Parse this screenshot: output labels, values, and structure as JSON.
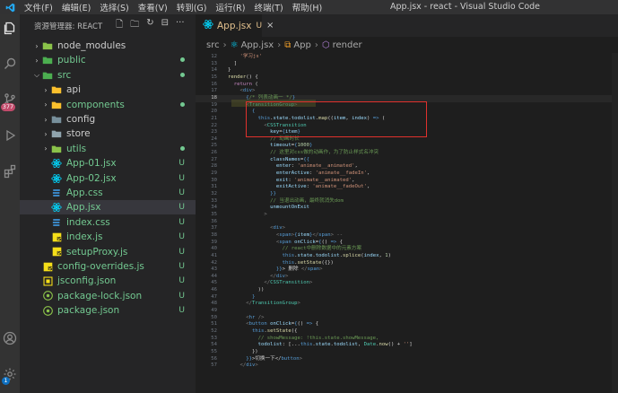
{
  "titlebar": {
    "menus": [
      "文件(F)",
      "编辑(E)",
      "选择(S)",
      "查看(V)",
      "转到(G)",
      "运行(R)",
      "终端(T)",
      "帮助(H)"
    ],
    "window_title": "App.jsx - react - Visual Studio Code"
  },
  "activity": {
    "items": [
      "explorer-icon",
      "search-icon",
      "source-control-icon",
      "run-debug-icon",
      "extensions-icon",
      "account-icon",
      "settings-icon"
    ],
    "scm_badge": "377",
    "settings_badge": "1"
  },
  "sidebar": {
    "title": "资源管理器: REACT",
    "actions": [
      "new-file-icon",
      "new-folder-icon",
      "refresh-icon",
      "collapse-icon",
      "more-icon"
    ],
    "items": [
      {
        "label": "node_modules",
        "type": "folder",
        "depth": 0,
        "expanded": false,
        "color": "#cccccc",
        "status": "",
        "icon_color": "#8bc34a"
      },
      {
        "label": "public",
        "type": "folder",
        "depth": 0,
        "expanded": false,
        "color": "#73c991",
        "status": "dot",
        "icon_color": "#4caf50"
      },
      {
        "label": "src",
        "type": "folder",
        "depth": 0,
        "expanded": true,
        "color": "#73c991",
        "status": "dot",
        "icon_color": "#4caf50"
      },
      {
        "label": "api",
        "type": "folder",
        "depth": 1,
        "expanded": false,
        "color": "#cccccc",
        "status": "",
        "icon_color": "#fbc02d"
      },
      {
        "label": "components",
        "type": "folder",
        "depth": 1,
        "expanded": false,
        "color": "#73c991",
        "status": "dot",
        "icon_color": "#fbc02d"
      },
      {
        "label": "config",
        "type": "folder",
        "depth": 1,
        "expanded": false,
        "color": "#cccccc",
        "status": "",
        "icon_color": "#78909c"
      },
      {
        "label": "store",
        "type": "folder",
        "depth": 1,
        "expanded": false,
        "color": "#cccccc",
        "status": "",
        "icon_color": "#90a4ae"
      },
      {
        "label": "utils",
        "type": "folder",
        "depth": 1,
        "expanded": false,
        "color": "#73c991",
        "status": "dot",
        "icon_color": "#8bc34a"
      },
      {
        "label": "App-01.jsx",
        "type": "react",
        "depth": 1,
        "color": "#73c991",
        "status": "U",
        "icon_color": "#00d8ff"
      },
      {
        "label": "App-02.jsx",
        "type": "react",
        "depth": 1,
        "color": "#73c991",
        "status": "U",
        "icon_color": "#00d8ff"
      },
      {
        "label": "App.css",
        "type": "css",
        "depth": 1,
        "color": "#73c991",
        "status": "U",
        "icon_color": "#42a5f5"
      },
      {
        "label": "App.jsx",
        "type": "react",
        "depth": 1,
        "color": "#73c991",
        "status": "U",
        "icon_color": "#00d8ff",
        "active": true
      },
      {
        "label": "index.css",
        "type": "css",
        "depth": 1,
        "color": "#73c991",
        "status": "U",
        "icon_color": "#42a5f5"
      },
      {
        "label": "index.js",
        "type": "js",
        "depth": 1,
        "color": "#73c991",
        "status": "U",
        "icon_color": "#f5de19"
      },
      {
        "label": "setupProxy.js",
        "type": "js",
        "depth": 1,
        "color": "#73c991",
        "status": "U",
        "icon_color": "#f5de19"
      },
      {
        "label": "config-overrides.js",
        "type": "js",
        "depth": 0,
        "color": "#73c991",
        "status": "U",
        "icon_color": "#f5de19"
      },
      {
        "label": "jsconfig.json",
        "type": "jsconfig",
        "depth": 0,
        "color": "#73c991",
        "status": "U",
        "icon_color": "#f5de19"
      },
      {
        "label": "package-lock.json",
        "type": "npm",
        "depth": 0,
        "color": "#73c991",
        "status": "U",
        "icon_color": "#8bc34a"
      },
      {
        "label": "package.json",
        "type": "npm",
        "depth": 0,
        "color": "#73c991",
        "status": "U",
        "icon_color": "#8bc34a"
      }
    ]
  },
  "editor": {
    "tab": {
      "name": "App.jsx",
      "status": "U",
      "close": "×"
    },
    "breadcrumb": [
      "src",
      "App.jsx",
      "App",
      "render"
    ],
    "current_line": "18",
    "lines": [
      {
        "n": "12",
        "t": [
          [
            "    '学习js'",
            "#ce9178"
          ]
        ]
      },
      {
        "n": "13",
        "t": [
          [
            "  ]",
            "#d4d4d4"
          ]
        ]
      },
      {
        "n": "14",
        "t": [
          [
            "}",
            "#d4d4d4"
          ]
        ]
      },
      {
        "n": "15",
        "t": [
          [
            "render",
            "#dcdcaa"
          ],
          [
            "() {",
            "#d4d4d4"
          ]
        ]
      },
      {
        "n": "16",
        "t": [
          [
            "  return",
            "#c586c0"
          ],
          [
            " (",
            "#d4d4d4"
          ]
        ]
      },
      {
        "n": "17",
        "t": [
          [
            "    <",
            "#808080"
          ],
          [
            "div",
            "#569cd6"
          ],
          [
            ">",
            "#808080"
          ]
        ]
      },
      {
        "n": "18",
        "t": [
          [
            "      {",
            "#569cd6"
          ],
          [
            "/* 列表动画一 */",
            "#6a9955"
          ],
          [
            "}",
            "#569cd6"
          ]
        ]
      },
      {
        "n": "19",
        "t": [
          [
            "      <",
            "#808080"
          ],
          [
            "TransitionGroup",
            "#4ec9b0"
          ],
          [
            ">",
            "#808080"
          ]
        ]
      },
      {
        "n": "20",
        "t": [
          [
            "        {",
            "#569cd6"
          ]
        ]
      },
      {
        "n": "21",
        "t": [
          [
            "          this",
            "#569cd6"
          ],
          [
            ".",
            "#d4d4d4"
          ],
          [
            "state",
            "#9cdcfe"
          ],
          [
            ".",
            "#d4d4d4"
          ],
          [
            "todolist",
            "#9cdcfe"
          ],
          [
            ".",
            "#d4d4d4"
          ],
          [
            "map",
            "#dcdcaa"
          ],
          [
            "((",
            "#d4d4d4"
          ],
          [
            "item",
            "#9cdcfe"
          ],
          [
            ", ",
            "#d4d4d4"
          ],
          [
            "index",
            "#9cdcfe"
          ],
          [
            ") ",
            "#d4d4d4"
          ],
          [
            "=>",
            "#569cd6"
          ],
          [
            " (",
            "#d4d4d4"
          ]
        ]
      },
      {
        "n": "22",
        "t": [
          [
            "            <",
            "#808080"
          ],
          [
            "CSSTransition",
            "#4ec9b0"
          ]
        ]
      },
      {
        "n": "23",
        "t": [
          [
            "              key",
            "#9cdcfe"
          ],
          [
            "=",
            "#d4d4d4"
          ],
          [
            "{",
            "#569cd6"
          ],
          [
            "item",
            "#9cdcfe"
          ],
          [
            "}",
            "#569cd6"
          ]
        ]
      },
      {
        "n": "24",
        "t": [
          [
            "              // 动画时长",
            "#6a9955"
          ]
        ]
      },
      {
        "n": "25",
        "t": [
          [
            "              timeout",
            "#9cdcfe"
          ],
          [
            "=",
            "#d4d4d4"
          ],
          [
            "{",
            "#569cd6"
          ],
          [
            "1000",
            "#b5cea8"
          ],
          [
            "}",
            "#569cd6"
          ]
        ]
      },
      {
        "n": "26",
        "t": [
          [
            "              // 这里对css做的动画作，为了防止样式名冲突",
            "#6a9955"
          ]
        ]
      },
      {
        "n": "27",
        "t": [
          [
            "              classNames",
            "#9cdcfe"
          ],
          [
            "=",
            "#d4d4d4"
          ],
          [
            "{{",
            "#569cd6"
          ]
        ]
      },
      {
        "n": "28",
        "t": [
          [
            "                enter",
            "#9cdcfe"
          ],
          [
            ": ",
            "#d4d4d4"
          ],
          [
            "'animate__animated'",
            "#ce9178"
          ],
          [
            ",",
            "#d4d4d4"
          ]
        ]
      },
      {
        "n": "29",
        "t": [
          [
            "                enterActive",
            "#9cdcfe"
          ],
          [
            ": ",
            "#d4d4d4"
          ],
          [
            "'animate__fadeIn'",
            "#ce9178"
          ],
          [
            ",",
            "#d4d4d4"
          ]
        ]
      },
      {
        "n": "30",
        "t": [
          [
            "                exit",
            "#9cdcfe"
          ],
          [
            ": ",
            "#d4d4d4"
          ],
          [
            "'animate__animated'",
            "#ce9178"
          ],
          [
            ",",
            "#d4d4d4"
          ]
        ]
      },
      {
        "n": "31",
        "t": [
          [
            "                exitActive",
            "#9cdcfe"
          ],
          [
            ": ",
            "#d4d4d4"
          ],
          [
            "'animate__fadeOut'",
            "#ce9178"
          ],
          [
            ",",
            "#d4d4d4"
          ]
        ]
      },
      {
        "n": "32",
        "t": [
          [
            "              }}",
            "#569cd6"
          ]
        ]
      },
      {
        "n": "33",
        "t": [
          [
            "              // 当退出动画，最终就消失dom",
            "#6a9955"
          ]
        ]
      },
      {
        "n": "34",
        "t": [
          [
            "              unmountOnExit",
            "#9cdcfe"
          ]
        ]
      },
      {
        "n": "35",
        "t": [
          [
            "            >",
            "#808080"
          ]
        ]
      },
      {
        "n": "36",
        "t": [
          [
            "",
            "#d4d4d4"
          ]
        ]
      },
      {
        "n": "37",
        "t": [
          [
            "              <",
            "#808080"
          ],
          [
            "div",
            "#569cd6"
          ],
          [
            ">",
            "#808080"
          ]
        ]
      },
      {
        "n": "38",
        "t": [
          [
            "                <",
            "#808080"
          ],
          [
            "span",
            "#569cd6"
          ],
          [
            ">",
            "#808080"
          ],
          [
            "{",
            "#569cd6"
          ],
          [
            "item",
            "#9cdcfe"
          ],
          [
            "}",
            "#569cd6"
          ],
          [
            "</",
            "#808080"
          ],
          [
            "span",
            "#569cd6"
          ],
          [
            "> --",
            "#808080"
          ]
        ]
      },
      {
        "n": "39",
        "t": [
          [
            "                <",
            "#808080"
          ],
          [
            "span",
            "#569cd6"
          ],
          [
            " onClick",
            "#9cdcfe"
          ],
          [
            "=",
            "#d4d4d4"
          ],
          [
            "{",
            "#569cd6"
          ],
          [
            "() ",
            "#d4d4d4"
          ],
          [
            "=>",
            "#569cd6"
          ],
          [
            " {",
            "#d4d4d4"
          ]
        ]
      },
      {
        "n": "40",
        "t": [
          [
            "                  // react中删除数据中的元素方案",
            "#6a9955"
          ]
        ]
      },
      {
        "n": "41",
        "t": [
          [
            "                  this",
            "#569cd6"
          ],
          [
            ".",
            "#d4d4d4"
          ],
          [
            "state",
            "#9cdcfe"
          ],
          [
            ".",
            "#d4d4d4"
          ],
          [
            "todolist",
            "#9cdcfe"
          ],
          [
            ".",
            "#d4d4d4"
          ],
          [
            "splice",
            "#dcdcaa"
          ],
          [
            "(",
            "#d4d4d4"
          ],
          [
            "index",
            "#9cdcfe"
          ],
          [
            ", ",
            "#d4d4d4"
          ],
          [
            "1",
            "#b5cea8"
          ],
          [
            ")",
            "#d4d4d4"
          ]
        ]
      },
      {
        "n": "42",
        "t": [
          [
            "                  this",
            "#569cd6"
          ],
          [
            ".",
            "#d4d4d4"
          ],
          [
            "setState",
            "#dcdcaa"
          ],
          [
            "({})",
            "#d4d4d4"
          ]
        ]
      },
      {
        "n": "43",
        "t": [
          [
            "                }}",
            "#569cd6"
          ],
          [
            "> 删除 ",
            "#d4d4d4"
          ],
          [
            "</",
            "#808080"
          ],
          [
            "span",
            "#569cd6"
          ],
          [
            ">",
            "#808080"
          ]
        ]
      },
      {
        "n": "44",
        "t": [
          [
            "              </",
            "#808080"
          ],
          [
            "div",
            "#569cd6"
          ],
          [
            ">",
            "#808080"
          ]
        ]
      },
      {
        "n": "45",
        "t": [
          [
            "            </",
            "#808080"
          ],
          [
            "CSSTransition",
            "#4ec9b0"
          ],
          [
            ">",
            "#808080"
          ]
        ]
      },
      {
        "n": "46",
        "t": [
          [
            "          ))",
            "#d4d4d4"
          ]
        ]
      },
      {
        "n": "47",
        "t": [
          [
            "        }",
            "#569cd6"
          ]
        ]
      },
      {
        "n": "48",
        "t": [
          [
            "      </",
            "#808080"
          ],
          [
            "TransitionGroup",
            "#4ec9b0"
          ],
          [
            ">",
            "#808080"
          ]
        ]
      },
      {
        "n": "49",
        "t": [
          [
            "",
            "#d4d4d4"
          ]
        ]
      },
      {
        "n": "50",
        "t": [
          [
            "      <",
            "#808080"
          ],
          [
            "hr",
            "#569cd6"
          ],
          [
            " />",
            "#808080"
          ]
        ]
      },
      {
        "n": "51",
        "t": [
          [
            "      <",
            "#808080"
          ],
          [
            "button",
            "#569cd6"
          ],
          [
            " onClick",
            "#9cdcfe"
          ],
          [
            "=",
            "#d4d4d4"
          ],
          [
            "{",
            "#569cd6"
          ],
          [
            "() ",
            "#d4d4d4"
          ],
          [
            "=>",
            "#569cd6"
          ],
          [
            " {",
            "#d4d4d4"
          ]
        ]
      },
      {
        "n": "52",
        "t": [
          [
            "        this",
            "#569cd6"
          ],
          [
            ".",
            "#d4d4d4"
          ],
          [
            "setState",
            "#dcdcaa"
          ],
          [
            "({",
            "#d4d4d4"
          ]
        ]
      },
      {
        "n": "53",
        "t": [
          [
            "          // showMessage: !this.state.showMessage,",
            "#6a9955"
          ]
        ]
      },
      {
        "n": "54",
        "t": [
          [
            "          todolist",
            "#9cdcfe"
          ],
          [
            ": [...",
            "#d4d4d4"
          ],
          [
            "this",
            "#569cd6"
          ],
          [
            ".",
            "#d4d4d4"
          ],
          [
            "state",
            "#9cdcfe"
          ],
          [
            ".",
            "#d4d4d4"
          ],
          [
            "todolist",
            "#9cdcfe"
          ],
          [
            ", ",
            "#d4d4d4"
          ],
          [
            "Date",
            "#4ec9b0"
          ],
          [
            ".",
            "#d4d4d4"
          ],
          [
            "now",
            "#dcdcaa"
          ],
          [
            "() + ",
            "#d4d4d4"
          ],
          [
            "''",
            "#ce9178"
          ],
          [
            "]",
            "#d4d4d4"
          ]
        ]
      },
      {
        "n": "55",
        "t": [
          [
            "        })",
            "#d4d4d4"
          ]
        ]
      },
      {
        "n": "56",
        "t": [
          [
            "      }}",
            "#569cd6"
          ],
          [
            ">切换一下</",
            "#d4d4d4"
          ],
          [
            "button",
            "#569cd6"
          ],
          [
            ">",
            "#808080"
          ]
        ]
      },
      {
        "n": "57",
        "t": [
          [
            "    </",
            "#808080"
          ],
          [
            "div",
            "#569cd6"
          ],
          [
            ">",
            "#808080"
          ]
        ]
      }
    ]
  }
}
